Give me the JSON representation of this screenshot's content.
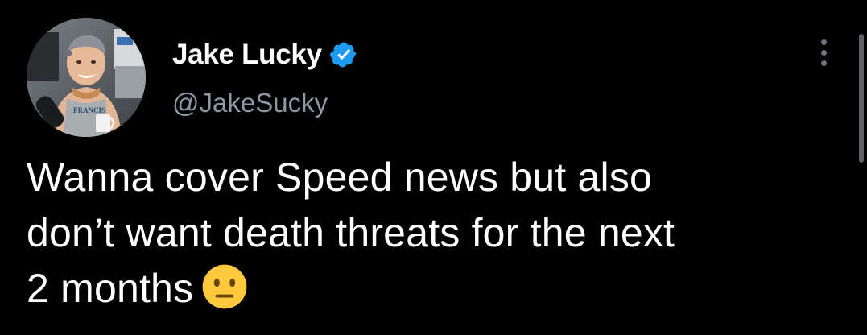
{
  "tweet": {
    "author": {
      "display_name": "Jake Lucky",
      "handle": "@JakeSucky",
      "verified": true
    },
    "text_lines": [
      "Wanna cover Speed news but also",
      "don’t want death threats for the next",
      "2 months"
    ],
    "emoji": "neutral-face-emoji",
    "more_options_icon": "more-options-icon"
  },
  "colors": {
    "background": "#000000",
    "name": "#ffffff",
    "handle": "#8b98a5",
    "text": "#ffffff",
    "verified_badge": "#1d9bf0",
    "emoji_face": "#ffc83d"
  }
}
